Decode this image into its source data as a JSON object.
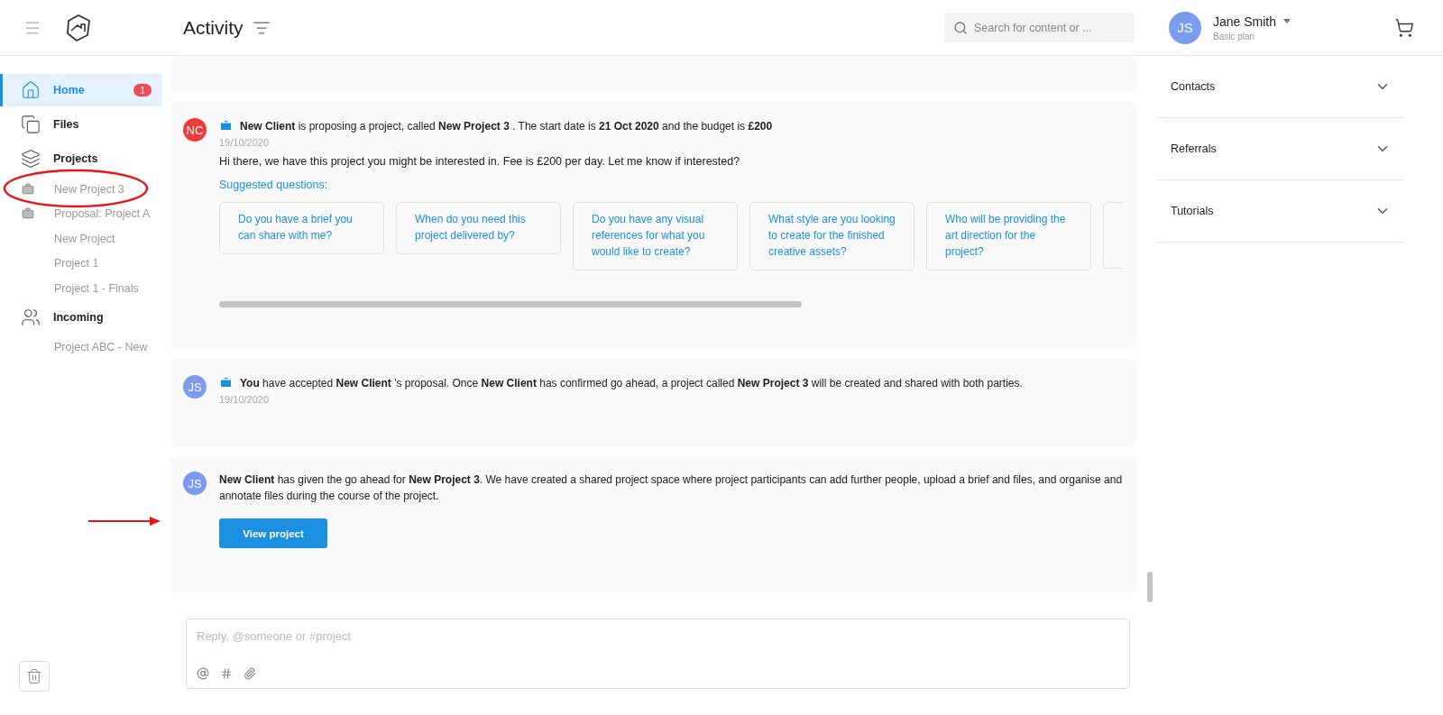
{
  "header": {
    "title": "Activity",
    "search": {
      "placeholder": "Search for content or ..."
    },
    "user": {
      "initials": "JS",
      "name": "Jane Smith",
      "plan": "Basic plan"
    }
  },
  "sidebar": {
    "items": [
      {
        "label": "Home",
        "selected": true,
        "badge": "1"
      },
      {
        "label": "Files",
        "selected": false
      },
      {
        "label": "Projects",
        "selected": false,
        "children": [
          {
            "label": "New Project 3",
            "briefcase": true,
            "annotated": true
          },
          {
            "label": "Proposal: Project A",
            "briefcase": true,
            "annotated": false
          },
          {
            "label": "New Project",
            "briefcase": false,
            "annotated": false
          },
          {
            "label": "Project 1",
            "briefcase": false,
            "annotated": false
          },
          {
            "label": "Project 1 - Finals",
            "briefcase": false,
            "annotated": false
          }
        ]
      },
      {
        "label": "Incoming",
        "selected": false,
        "children": [
          {
            "label": "Project ABC - New",
            "briefcase": false,
            "annotated": false
          }
        ]
      }
    ]
  },
  "feed": [
    {
      "kind": "partial"
    },
    {
      "kind": "proposal",
      "initials": "NC",
      "color": "#ef3b3b",
      "briefcase": true,
      "text": "**New Client** is proposing a project, called **New Project 3** . The start date is **21 Oct 2020** and the budget is **£200**",
      "date": "19/10/2020",
      "body": "Hi there, we have this project you might be interested in. Fee is £200 per day. Let me know if interested?",
      "questions_title": "Suggested questions:",
      "questions": [
        "Do you have a brief you can share with me?",
        "When do you need this project delivered by?",
        "Do you have any visual references for what you would like to create?",
        "What style are you looking to create for the finished creative assets?",
        "Who will be providing the art direction for the project?"
      ]
    },
    {
      "kind": "accepted",
      "initials": "JS",
      "color": "#7b9bef",
      "briefcase": true,
      "text": "**You** have accepted **New Client** 's proposal. Once **New Client** has confirmed go ahead, a project called **New Project 3** will be created and shared with both parties.",
      "date": "19/10/2020"
    },
    {
      "kind": "go_ahead",
      "initials": "JS",
      "color": "#7b9bef",
      "briefcase": false,
      "text": "**New Client** has given the go ahead for **New Project 3**. We have created a shared project space where project participants can add further people, upload a brief and files, and organise and annotate files during the course of the project.",
      "button": "View project",
      "annotated": true
    }
  ],
  "reply": {
    "placeholder": "Reply, @someone or #project"
  },
  "right_panel": {
    "sections": [
      {
        "label": "Contacts",
        "expanded": false
      },
      {
        "label": "Referrals",
        "expanded": false
      },
      {
        "label": "Tutorials",
        "expanded": false
      }
    ]
  }
}
